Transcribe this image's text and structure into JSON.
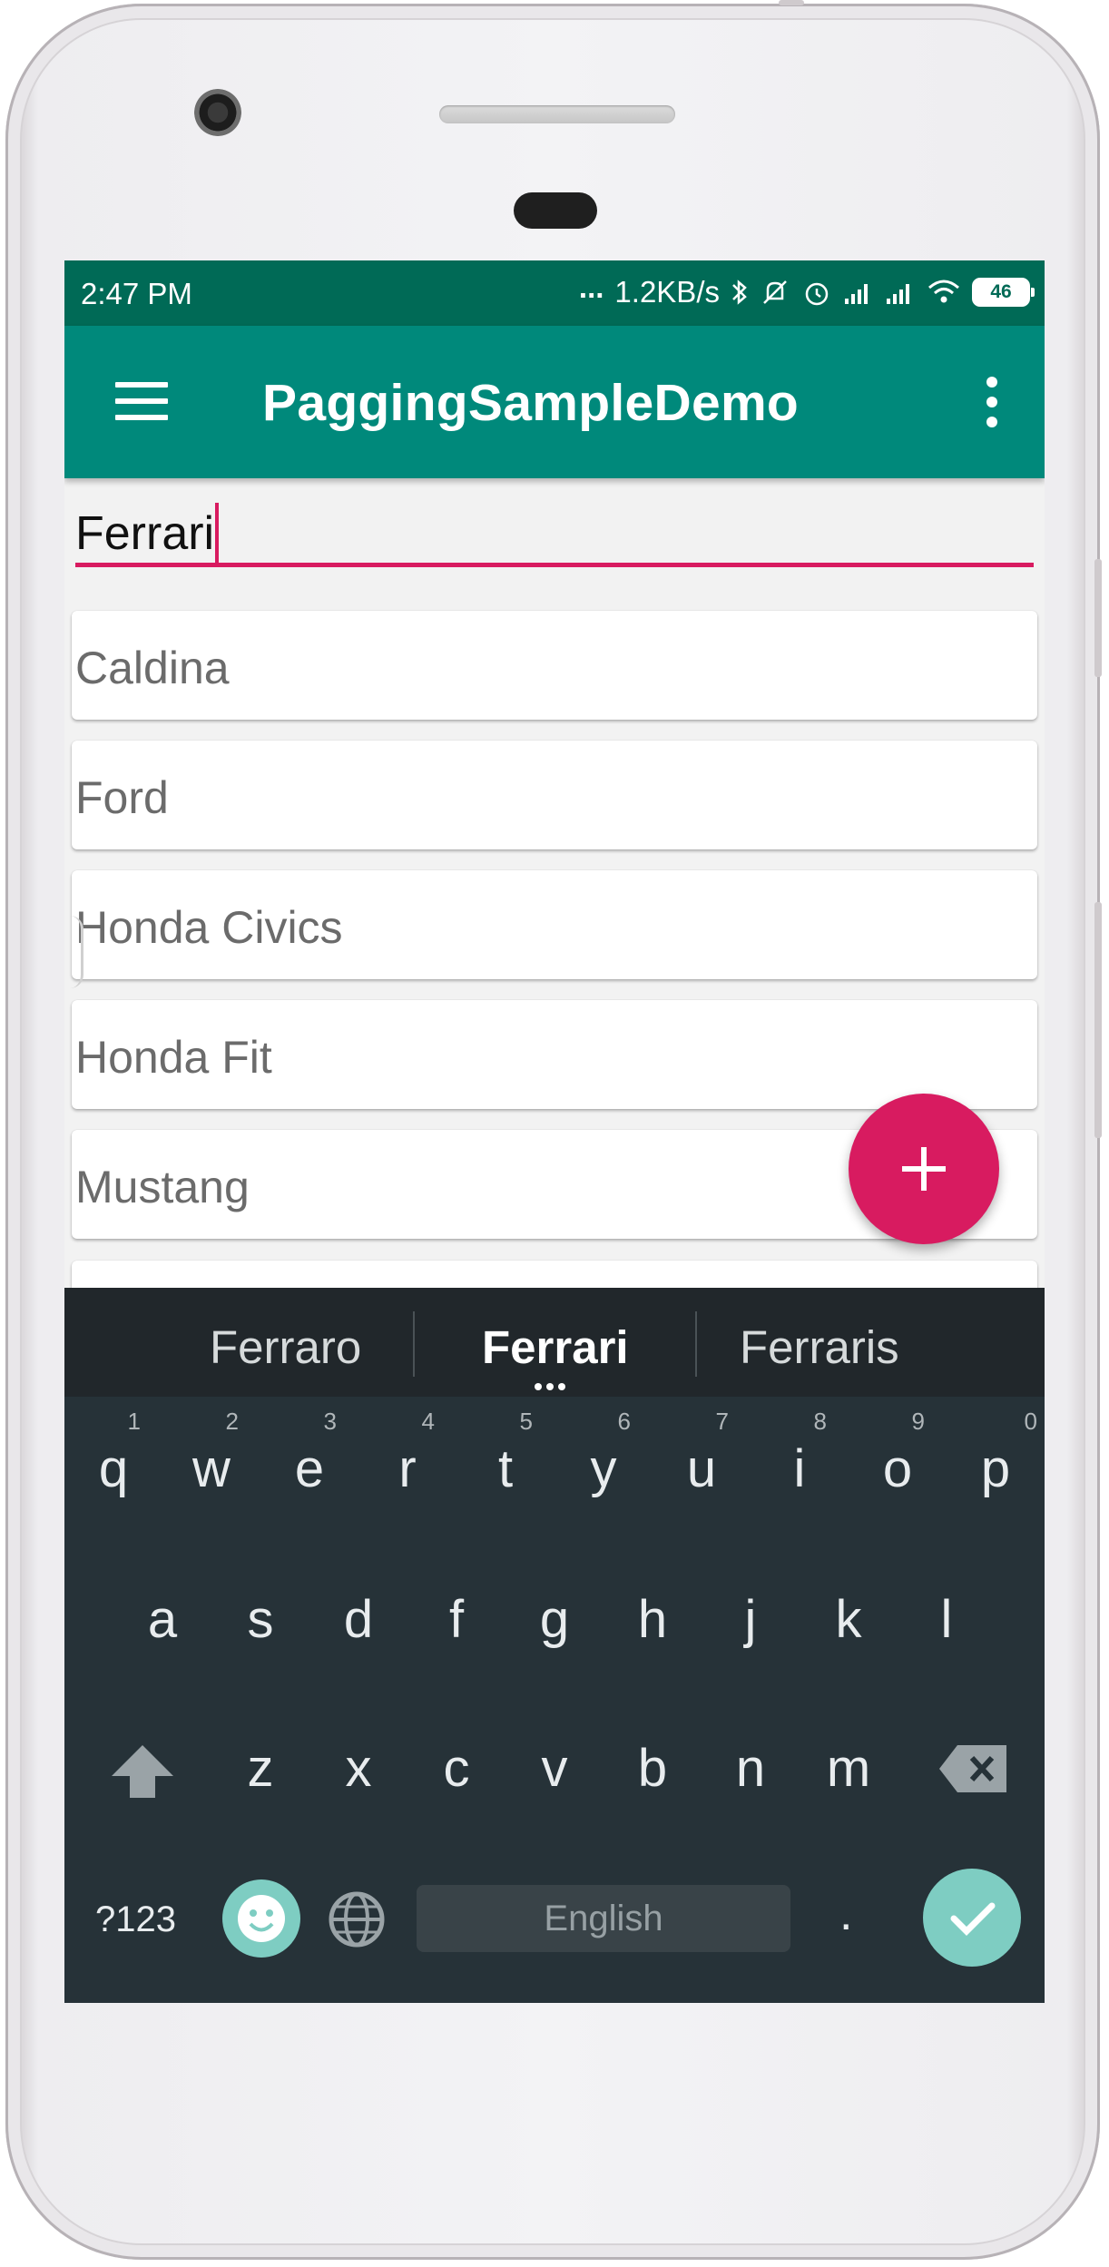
{
  "status_bar": {
    "time": "2:47  PM",
    "dots": "...",
    "net_speed": "1.2KB/s",
    "battery": "46"
  },
  "app_bar": {
    "title": "PaggingSampleDemo"
  },
  "search": {
    "value": "Ferrari"
  },
  "list": {
    "items": [
      "Caldina",
      "Ford",
      "Honda Civics",
      "Honda Fit",
      "Mustang"
    ]
  },
  "keyboard": {
    "suggestions": [
      "Ferraro",
      "Ferrari",
      "Ferraris"
    ],
    "row1": [
      {
        "key": "q",
        "hint": "1"
      },
      {
        "key": "w",
        "hint": "2"
      },
      {
        "key": "e",
        "hint": "3"
      },
      {
        "key": "r",
        "hint": "4"
      },
      {
        "key": "t",
        "hint": "5"
      },
      {
        "key": "y",
        "hint": "6"
      },
      {
        "key": "u",
        "hint": "7"
      },
      {
        "key": "i",
        "hint": "8"
      },
      {
        "key": "o",
        "hint": "9"
      },
      {
        "key": "p",
        "hint": "0"
      }
    ],
    "row2": [
      "a",
      "s",
      "d",
      "f",
      "g",
      "h",
      "j",
      "k",
      "l"
    ],
    "row3": [
      "z",
      "x",
      "c",
      "v",
      "b",
      "n",
      "m"
    ],
    "symbols_label": "?123",
    "space_label": "English",
    "period": "."
  },
  "colors": {
    "status_bar": "#006a56",
    "app_bar": "#00897b",
    "accent": "#d81b60",
    "keyboard": "#263238",
    "keyboard_accent": "#7ecdc2"
  }
}
